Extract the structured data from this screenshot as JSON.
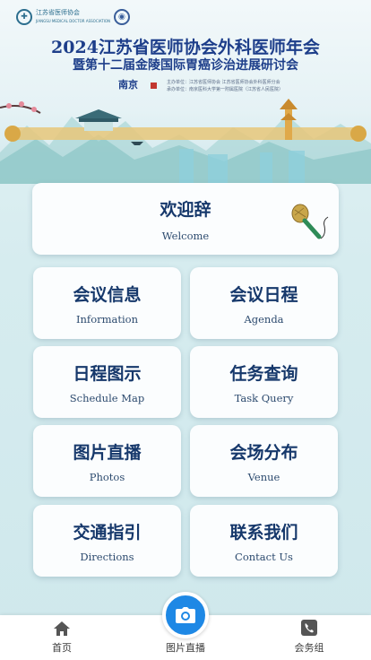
{
  "header": {
    "org_name": "江苏省医师协会",
    "org_sub": "JIANGSU MEDICAL DOCTOR ASSOCIATION",
    "title_line1": "2024江苏省医师协会外科医师年会",
    "title_line2": "暨第十二届金陵国际胃癌诊治进展研讨会",
    "city_mark": "南京",
    "info_line1": "主办单位：江苏省医师协会 江苏省医师协会外科医师分会",
    "info_line2": "承办单位：南京医科大学第一附属医院（江苏省人民医院）"
  },
  "welcome": {
    "zh": "欢迎辞",
    "en": "Welcome"
  },
  "menu": [
    {
      "zh": "会议信息",
      "en": "Information"
    },
    {
      "zh": "会议日程",
      "en": "Agenda"
    },
    {
      "zh": "日程图示",
      "en": "Schedule Map"
    },
    {
      "zh": "任务查询",
      "en": "Task Query"
    },
    {
      "zh": "图片直播",
      "en": "Photos"
    },
    {
      "zh": "会场分布",
      "en": "Venue"
    },
    {
      "zh": "交通指引",
      "en": "Directions"
    },
    {
      "zh": "联系我们",
      "en": "Contact  Us"
    }
  ],
  "tabbar": {
    "home": "首页",
    "photos": "图片直播",
    "service": "会务组",
    "accent_color": "#1e88e5"
  },
  "icons": {
    "home": "home-icon",
    "camera": "camera-icon",
    "phone": "phone-icon",
    "microphone": "microphone-icon"
  }
}
